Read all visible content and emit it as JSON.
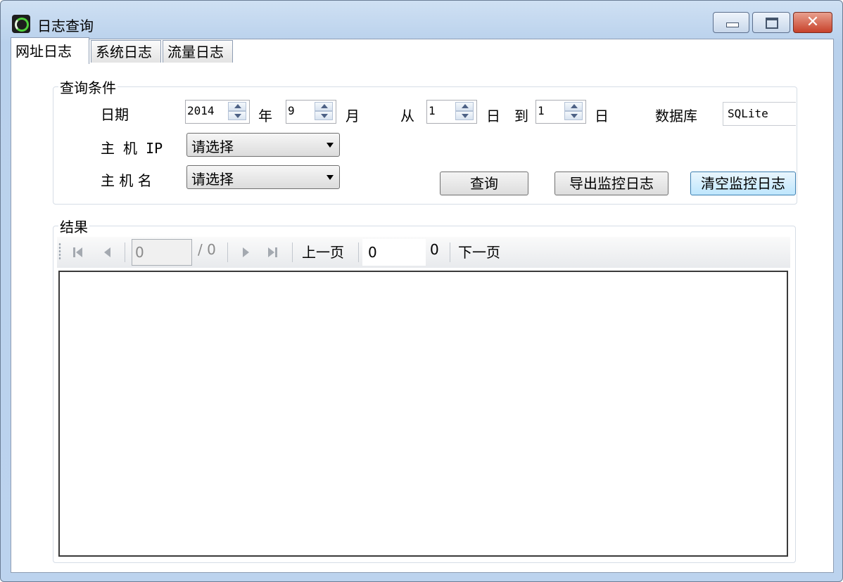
{
  "window": {
    "title": "日志查询"
  },
  "title_buttons": {
    "close": "✕"
  },
  "tabs": [
    {
      "label": "网址日志",
      "active": true
    },
    {
      "label": "系统日志",
      "active": false
    },
    {
      "label": "流量日志",
      "active": false
    }
  ],
  "query": {
    "group_title": "查询条件",
    "date_label": "日期",
    "year_value": "2014",
    "year_unit": "年",
    "month_value": "9",
    "month_unit": "月",
    "from_label": "从",
    "from_day": "1",
    "day_unit_1": "日",
    "to_label": "到",
    "to_day": "1",
    "day_unit_2": "日",
    "db_label": "数据库",
    "db_value": "SQLite",
    "host_ip_label": "主 机 IP",
    "host_ip_value": "请选择",
    "host_name_label": "主 机 名",
    "host_name_value": "请选择",
    "query_button": "查询",
    "export_button": "导出监控日志",
    "clear_button": "清空监控日志"
  },
  "results": {
    "group_title": "结果",
    "page_input": "0",
    "total_pages": "/ 0",
    "prev_label": "上一页",
    "page_field": "0",
    "page_count": "0",
    "next_label": "下一页"
  }
}
